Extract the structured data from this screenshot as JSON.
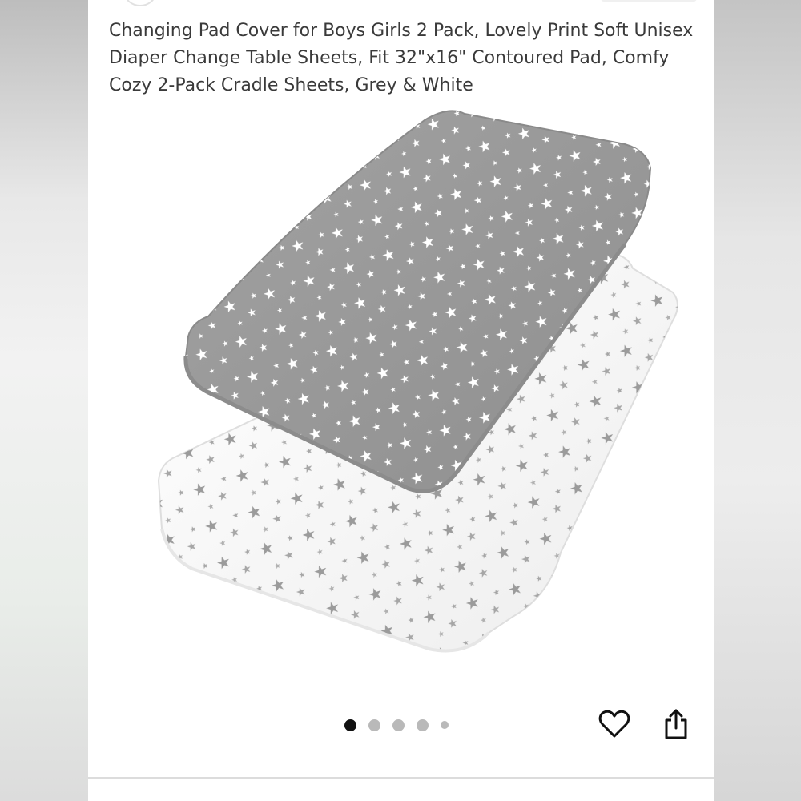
{
  "product": {
    "title": "Changing Pad Cover for Boys Girls 2 Pack, Lovely Print Soft Unisex Diaper Change Table Sheets, Fit 32\"x16\" Contoured Pad, Comfy Cozy 2-Pack Cradle Sheets, Grey & White",
    "image": {
      "subject": "two-changing-pad-covers",
      "covers": [
        {
          "fabric": "#9c9c9c",
          "star": "#ffffff"
        },
        {
          "fabric": "#ffffff",
          "star": "#9b9b9b"
        }
      ]
    }
  },
  "carousel": {
    "total": 5,
    "active": 0
  },
  "actions": {
    "favorite_icon": "heart-outline-icon",
    "share_icon": "share-icon"
  },
  "colors": {
    "title_text": "#3a3a3a",
    "dot_active": "#111111",
    "dot_inactive": "#b9b9b9",
    "icon": "#111111"
  }
}
